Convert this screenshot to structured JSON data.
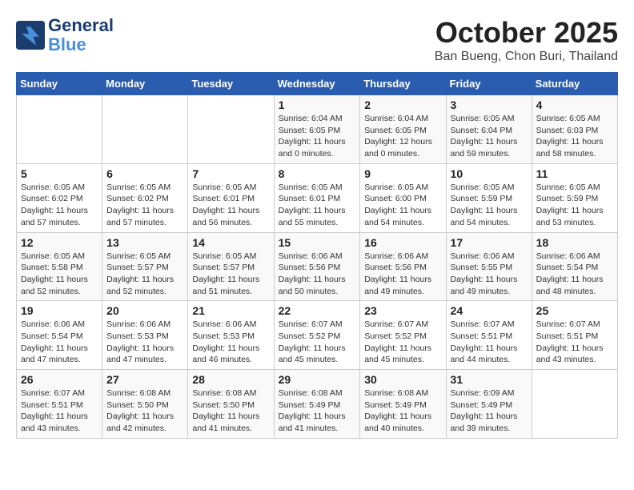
{
  "header": {
    "logo_line1": "General",
    "logo_line2": "Blue",
    "month": "October 2025",
    "location": "Ban Bueng, Chon Buri, Thailand"
  },
  "weekdays": [
    "Sunday",
    "Monday",
    "Tuesday",
    "Wednesday",
    "Thursday",
    "Friday",
    "Saturday"
  ],
  "weeks": [
    [
      {
        "day": "",
        "detail": ""
      },
      {
        "day": "",
        "detail": ""
      },
      {
        "day": "",
        "detail": ""
      },
      {
        "day": "1",
        "detail": "Sunrise: 6:04 AM\nSunset: 6:05 PM\nDaylight: 11 hours\nand 0 minutes."
      },
      {
        "day": "2",
        "detail": "Sunrise: 6:04 AM\nSunset: 6:05 PM\nDaylight: 12 hours\nand 0 minutes."
      },
      {
        "day": "3",
        "detail": "Sunrise: 6:05 AM\nSunset: 6:04 PM\nDaylight: 11 hours\nand 59 minutes."
      },
      {
        "day": "4",
        "detail": "Sunrise: 6:05 AM\nSunset: 6:03 PM\nDaylight: 11 hours\nand 58 minutes."
      }
    ],
    [
      {
        "day": "5",
        "detail": "Sunrise: 6:05 AM\nSunset: 6:02 PM\nDaylight: 11 hours\nand 57 minutes."
      },
      {
        "day": "6",
        "detail": "Sunrise: 6:05 AM\nSunset: 6:02 PM\nDaylight: 11 hours\nand 57 minutes."
      },
      {
        "day": "7",
        "detail": "Sunrise: 6:05 AM\nSunset: 6:01 PM\nDaylight: 11 hours\nand 56 minutes."
      },
      {
        "day": "8",
        "detail": "Sunrise: 6:05 AM\nSunset: 6:01 PM\nDaylight: 11 hours\nand 55 minutes."
      },
      {
        "day": "9",
        "detail": "Sunrise: 6:05 AM\nSunset: 6:00 PM\nDaylight: 11 hours\nand 54 minutes."
      },
      {
        "day": "10",
        "detail": "Sunrise: 6:05 AM\nSunset: 5:59 PM\nDaylight: 11 hours\nand 54 minutes."
      },
      {
        "day": "11",
        "detail": "Sunrise: 6:05 AM\nSunset: 5:59 PM\nDaylight: 11 hours\nand 53 minutes."
      }
    ],
    [
      {
        "day": "12",
        "detail": "Sunrise: 6:05 AM\nSunset: 5:58 PM\nDaylight: 11 hours\nand 52 minutes."
      },
      {
        "day": "13",
        "detail": "Sunrise: 6:05 AM\nSunset: 5:57 PM\nDaylight: 11 hours\nand 52 minutes."
      },
      {
        "day": "14",
        "detail": "Sunrise: 6:05 AM\nSunset: 5:57 PM\nDaylight: 11 hours\nand 51 minutes."
      },
      {
        "day": "15",
        "detail": "Sunrise: 6:06 AM\nSunset: 5:56 PM\nDaylight: 11 hours\nand 50 minutes."
      },
      {
        "day": "16",
        "detail": "Sunrise: 6:06 AM\nSunset: 5:56 PM\nDaylight: 11 hours\nand 49 minutes."
      },
      {
        "day": "17",
        "detail": "Sunrise: 6:06 AM\nSunset: 5:55 PM\nDaylight: 11 hours\nand 49 minutes."
      },
      {
        "day": "18",
        "detail": "Sunrise: 6:06 AM\nSunset: 5:54 PM\nDaylight: 11 hours\nand 48 minutes."
      }
    ],
    [
      {
        "day": "19",
        "detail": "Sunrise: 6:06 AM\nSunset: 5:54 PM\nDaylight: 11 hours\nand 47 minutes."
      },
      {
        "day": "20",
        "detail": "Sunrise: 6:06 AM\nSunset: 5:53 PM\nDaylight: 11 hours\nand 47 minutes."
      },
      {
        "day": "21",
        "detail": "Sunrise: 6:06 AM\nSunset: 5:53 PM\nDaylight: 11 hours\nand 46 minutes."
      },
      {
        "day": "22",
        "detail": "Sunrise: 6:07 AM\nSunset: 5:52 PM\nDaylight: 11 hours\nand 45 minutes."
      },
      {
        "day": "23",
        "detail": "Sunrise: 6:07 AM\nSunset: 5:52 PM\nDaylight: 11 hours\nand 45 minutes."
      },
      {
        "day": "24",
        "detail": "Sunrise: 6:07 AM\nSunset: 5:51 PM\nDaylight: 11 hours\nand 44 minutes."
      },
      {
        "day": "25",
        "detail": "Sunrise: 6:07 AM\nSunset: 5:51 PM\nDaylight: 11 hours\nand 43 minutes."
      }
    ],
    [
      {
        "day": "26",
        "detail": "Sunrise: 6:07 AM\nSunset: 5:51 PM\nDaylight: 11 hours\nand 43 minutes."
      },
      {
        "day": "27",
        "detail": "Sunrise: 6:08 AM\nSunset: 5:50 PM\nDaylight: 11 hours\nand 42 minutes."
      },
      {
        "day": "28",
        "detail": "Sunrise: 6:08 AM\nSunset: 5:50 PM\nDaylight: 11 hours\nand 41 minutes."
      },
      {
        "day": "29",
        "detail": "Sunrise: 6:08 AM\nSunset: 5:49 PM\nDaylight: 11 hours\nand 41 minutes."
      },
      {
        "day": "30",
        "detail": "Sunrise: 6:08 AM\nSunset: 5:49 PM\nDaylight: 11 hours\nand 40 minutes."
      },
      {
        "day": "31",
        "detail": "Sunrise: 6:09 AM\nSunset: 5:49 PM\nDaylight: 11 hours\nand 39 minutes."
      },
      {
        "day": "",
        "detail": ""
      }
    ]
  ]
}
